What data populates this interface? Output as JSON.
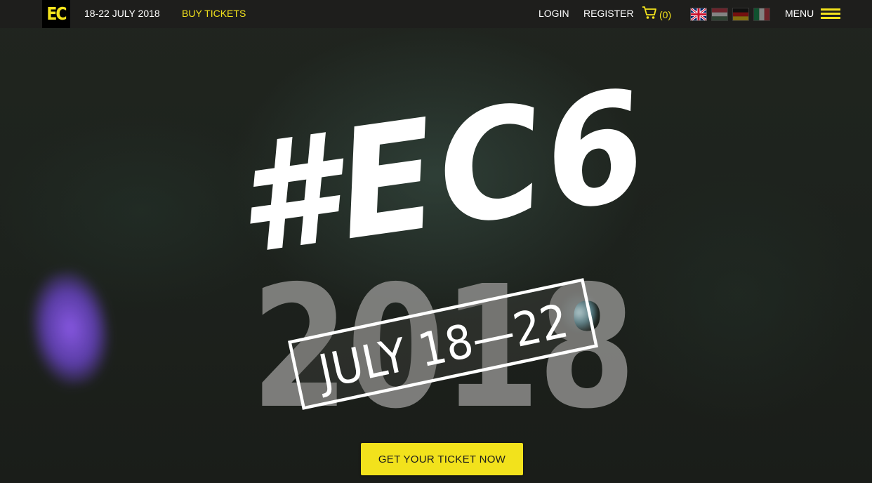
{
  "header": {
    "logo_text": "EC",
    "date_label": "18-22 JULY 2018",
    "buy_tickets_label": "BUY TICKETS",
    "login_label": "LOGIN",
    "register_label": "REGISTER",
    "cart_count": "(0)",
    "menu_label": "MENU",
    "languages": [
      "en",
      "hu",
      "de",
      "it"
    ],
    "accent_color": "#f2e21c"
  },
  "hero": {
    "hashtag": "#EC6",
    "year": "2018",
    "dates_stamp": "JULY 18—22",
    "cta_label": "GET YOUR TICKET NOW"
  },
  "icons": [
    "cart-icon",
    "flag-en-icon",
    "flag-hu-icon",
    "flag-de-icon",
    "flag-it-icon",
    "hamburger-icon"
  ]
}
